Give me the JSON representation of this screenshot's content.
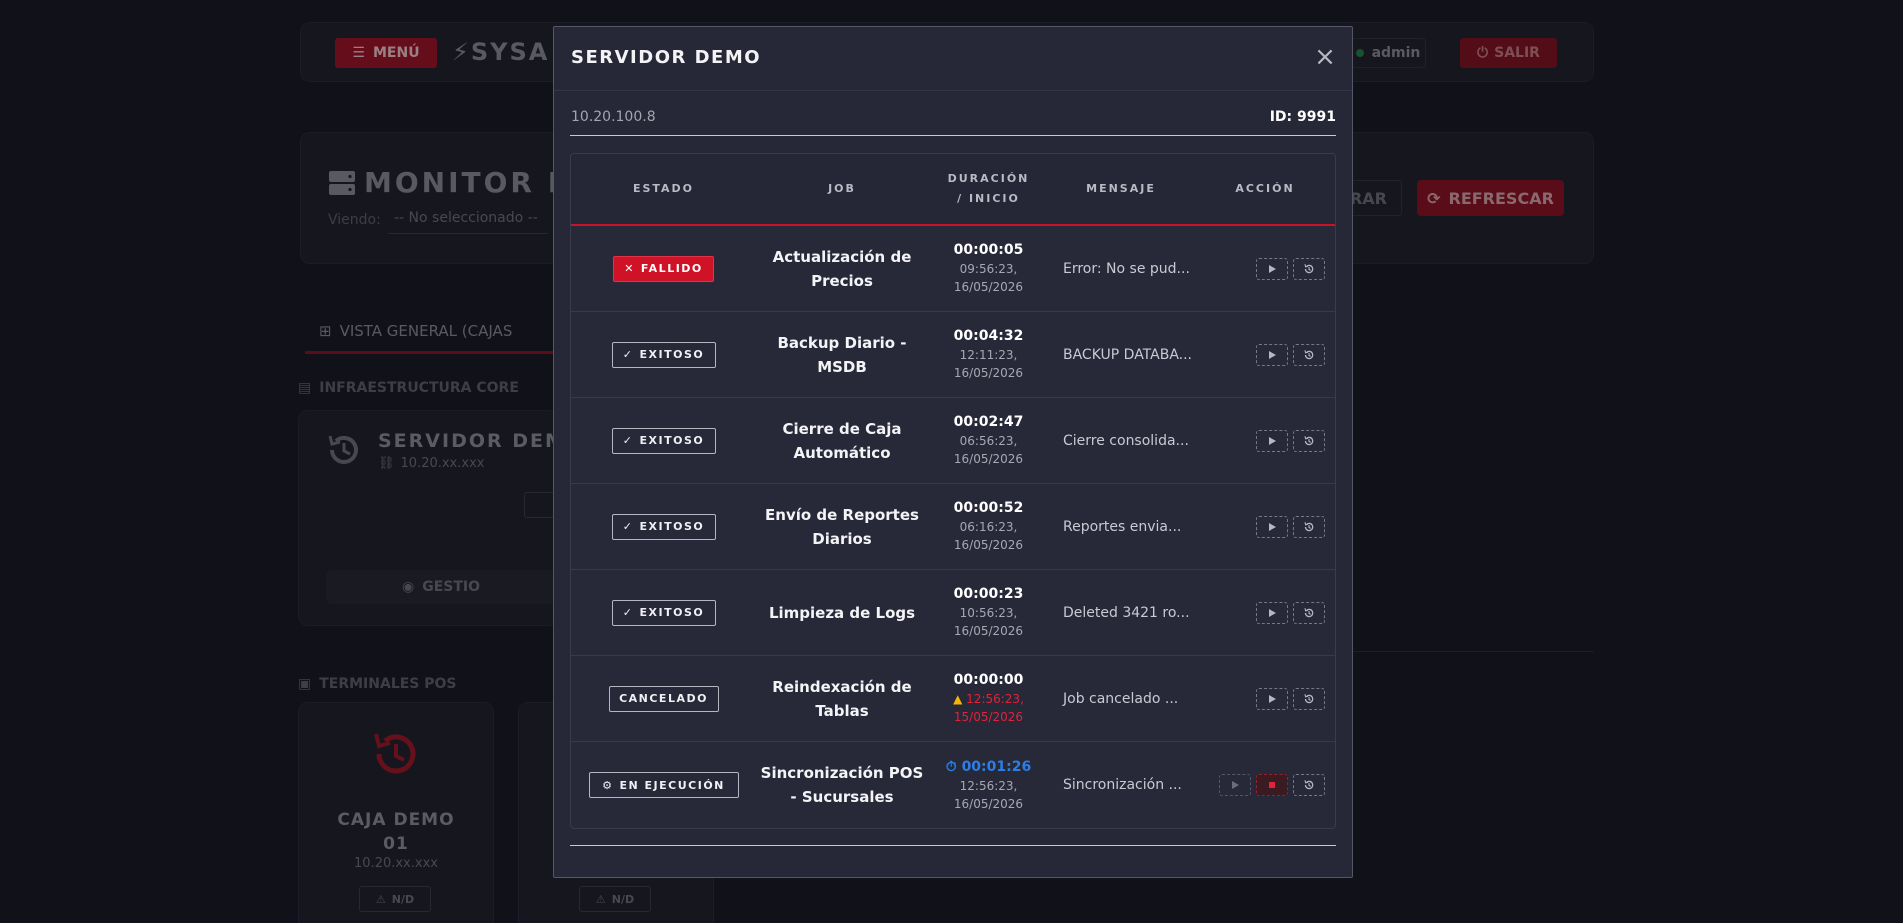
{
  "background": {
    "menu_label": "MENÚ",
    "brand": "SYSA",
    "user": "admin",
    "exit_label": "SALIR",
    "monitor_title": "MONITOR PO",
    "viendo_label": "Viendo:",
    "viendo_value": "-- No seleccionado --",
    "filter_label": "RAR",
    "refresh_label": "REFRESCAR",
    "tab_general": "VISTA GENERAL (CAJAS",
    "section_core": "INFRAESTRUCTURA CORE",
    "server_name": "SERVIDOR DEMO",
    "server_ip": "10.20.xx.xxx",
    "gestionar_label": "GESTIO",
    "section_pos": "TERMINALES POS",
    "pos_name_line1": "CAJA DEMO",
    "pos_name_line2": "01",
    "pos_ip": "10.20.xx.xxx",
    "pos_badge": "N/D",
    "pos_badge2": "N/D"
  },
  "modal": {
    "title": "SERVIDOR DEMO",
    "ip": "10.20.100.8",
    "id_text": "ID: 9991",
    "columns": {
      "estado": "ESTADO",
      "job": "JOB",
      "duracion": "DURACIÓN\n/ INICIO",
      "mensaje": "MENSAJE",
      "accion": "ACCIÓN"
    },
    "jobs": [
      {
        "status": "FALLIDO",
        "name": "Actualización de Precios",
        "duration": "00:00:05",
        "start": "09:56:23,",
        "date": "16/05/2026",
        "message": "Error: No se pud..."
      },
      {
        "status": "EXITOSO",
        "name": "Backup Diario - MSDB",
        "duration": "00:04:32",
        "start": "12:11:23,",
        "date": "16/05/2026",
        "message": "BACKUP DATABA..."
      },
      {
        "status": "EXITOSO",
        "name": "Cierre de Caja Automático",
        "duration": "00:02:47",
        "start": "06:56:23,",
        "date": "16/05/2026",
        "message": "Cierre consolida..."
      },
      {
        "status": "EXITOSO",
        "name": "Envío de Reportes Diarios",
        "duration": "00:00:52",
        "start": "06:16:23,",
        "date": "16/05/2026",
        "message": "Reportes envia..."
      },
      {
        "status": "EXITOSO",
        "name": "Limpieza de Logs",
        "duration": "00:00:23",
        "start": "10:56:23,",
        "date": "16/05/2026",
        "message": "Deleted 3421 ro..."
      },
      {
        "status": "CANCELADO",
        "name": "Reindexación de Tablas",
        "duration": "00:00:00",
        "start": "12:56:23,",
        "date": "15/05/2026",
        "message": "Job cancelado ..."
      },
      {
        "status": "EN EJECUCIÓN",
        "name": "Sincronización POS - Sucursales",
        "duration": "00:01:26",
        "start": "12:56:23,",
        "date": "16/05/2026",
        "message": "Sincronización ..."
      }
    ]
  },
  "colors": {
    "accent_red": "#d01226",
    "running_blue": "#2b7fe6",
    "warning_yellow": "#f2b705",
    "modal_bg": "#262737"
  }
}
